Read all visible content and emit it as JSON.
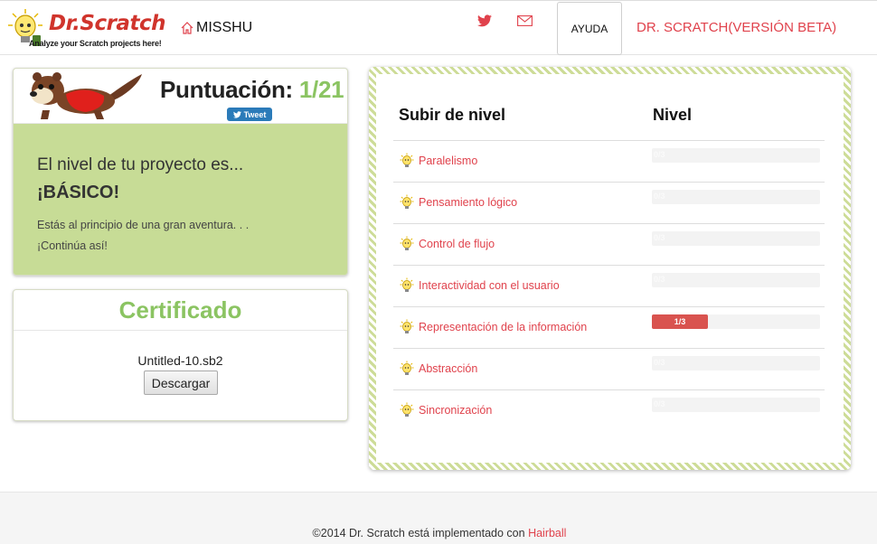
{
  "nav": {
    "logo_title": "Dr.Scratch",
    "logo_subtitle": "Analyze your Scratch projects here!",
    "home_label": "MISSHU",
    "help_label": "AYUDA",
    "beta_label": "DR. SCRATCH(VERSIÓN BETA)",
    "icons": [
      "home-icon",
      "twitter-icon",
      "mail-icon"
    ]
  },
  "score": {
    "label": "Puntuación:",
    "value": "1/21",
    "tweet_label": "Tweet",
    "level_heading": "El nivel de tu proyecto es...",
    "level_value": "¡BÁSICO!",
    "desc_line1": "Estás al principio de una gran aventura. . .",
    "desc_line2": "¡Continúa así!"
  },
  "certificate": {
    "title": "Certificado",
    "filename": "Untitled-10.sb2",
    "download_label": "Descargar"
  },
  "levels": {
    "col_skill": "Subir de nivel",
    "col_level": "Nivel",
    "rows": [
      {
        "label": "Paralelismo",
        "score": 0,
        "max": 3,
        "text": "0/3"
      },
      {
        "label": "Pensamiento lógico",
        "score": 0,
        "max": 3,
        "text": "0/3"
      },
      {
        "label": "Control de flujo",
        "score": 0,
        "max": 3,
        "text": "0/3"
      },
      {
        "label": "Interactividad con el usuario",
        "score": 0,
        "max": 3,
        "text": "0/3"
      },
      {
        "label": "Representación de la información",
        "score": 1,
        "max": 3,
        "text": "1/3"
      },
      {
        "label": "Abstracción",
        "score": 0,
        "max": 3,
        "text": "0/3"
      },
      {
        "label": "Sincronización",
        "score": 0,
        "max": 3,
        "text": "0/3"
      }
    ]
  },
  "footer": {
    "text": "©2014 Dr. Scratch está implementado con",
    "link": "Hairball"
  },
  "colors": {
    "accent_red": "#e0424c",
    "accent_green": "#8bc462",
    "card_green": "#c7dc96",
    "bar_red": "#d9534f"
  }
}
